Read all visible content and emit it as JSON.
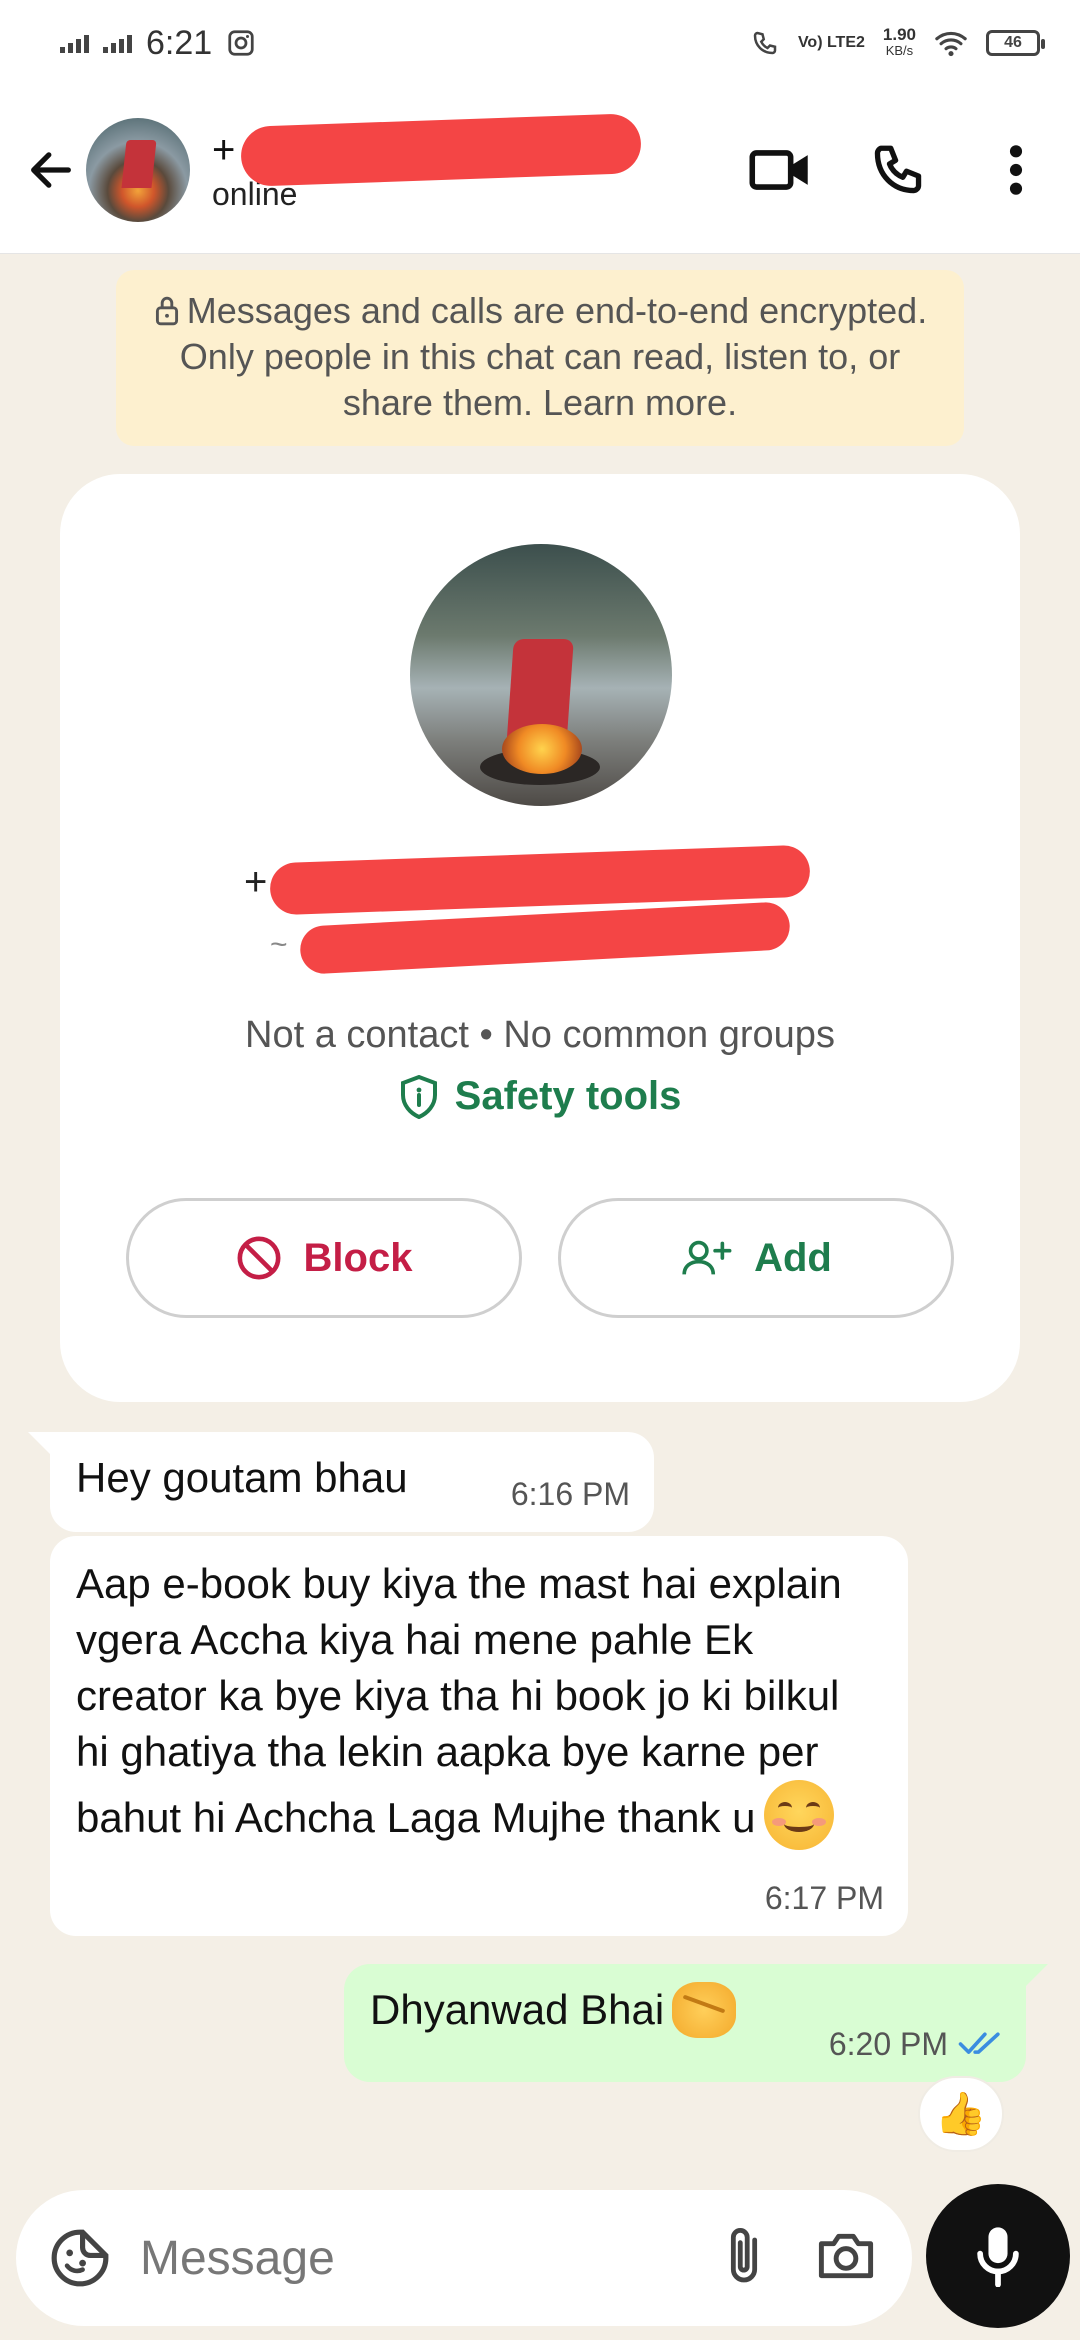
{
  "status_bar": {
    "time": "6:21",
    "network": "Vo) LTE2",
    "speed": "1.90",
    "speed_unit": "KB/s",
    "battery": "46"
  },
  "header": {
    "name_prefix": "+",
    "status": "online"
  },
  "encryption_notice": "Messages and calls are end-to-end encrypted. Only people in this chat can read, listen to, or share them. Learn more.",
  "profile_card": {
    "name_prefix": "+",
    "subname_prefix": "~",
    "meta": "Not a contact • No common groups",
    "safety_tools": "Safety tools",
    "block_label": "Block",
    "add_label": "Add"
  },
  "messages": [
    {
      "direction": "in",
      "text": "Hey goutam bhau",
      "time": "6:16 PM"
    },
    {
      "direction": "in",
      "text": "Aap e-book buy kiya the mast hai explain vgera Accha kiya hai mene pahle Ek creator ka bye kiya tha hi book jo ki bilkul hi ghatiya tha lekin aapka bye karne per bahut hi Achcha Laga Mujhe thank u",
      "time": "6:17 PM",
      "emoji": "smiling-face-icon"
    },
    {
      "direction": "out",
      "text": "Dhyanwad Bhai",
      "time": "6:20 PM",
      "emoji": "handshake-icon",
      "read": true
    }
  ],
  "reaction": "👍",
  "input": {
    "placeholder": "Message"
  },
  "colors": {
    "accent_green": "#1e7d4d",
    "block_red": "#c41e46",
    "outgoing_bubble": "#d9fdd3",
    "chat_bg": "#f4efe6",
    "encryption_bg": "#fdf0cf",
    "read_ticks": "#3b8de0"
  }
}
